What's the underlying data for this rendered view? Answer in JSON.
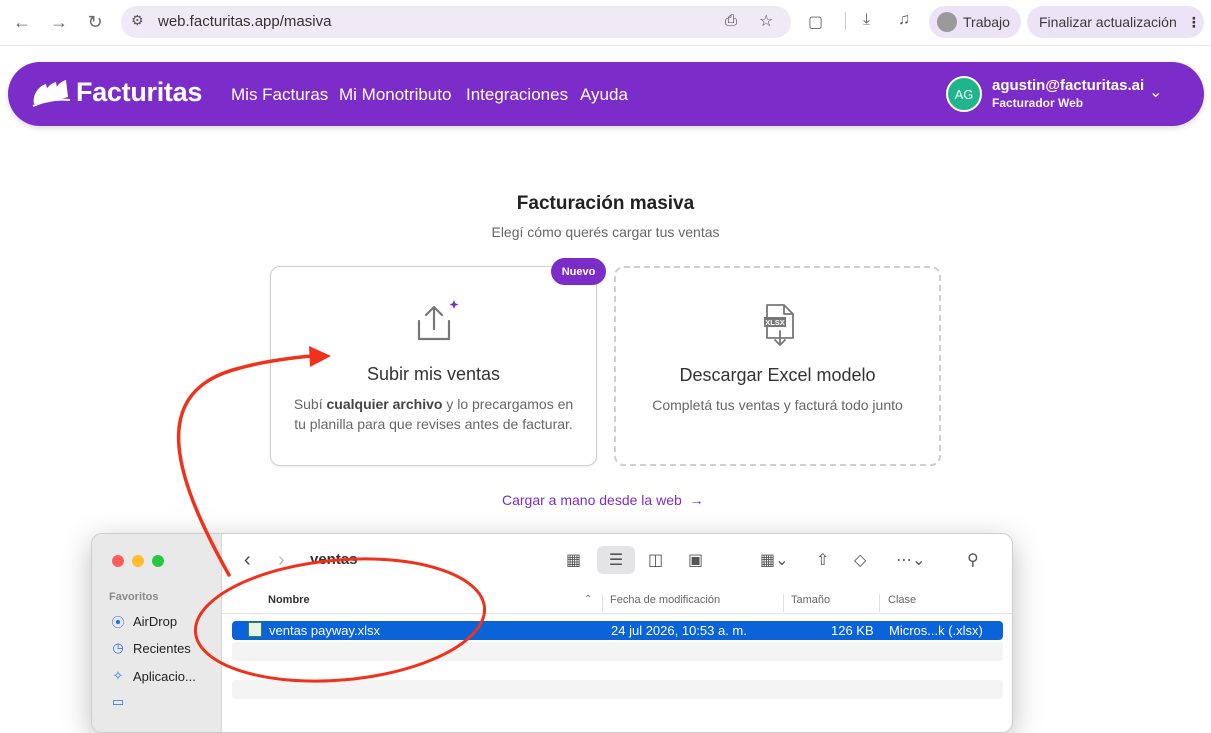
{
  "browser": {
    "url": "web.facturitas.app/masiva",
    "profile_label": "Trabajo",
    "update_label": "Finalizar actualización"
  },
  "header": {
    "brand": "Facturitas",
    "nav": [
      "Mis Facturas",
      "Mi Monotributo",
      "Integraciones",
      "Ayuda"
    ],
    "avatar_initials": "AG",
    "user_email": "agustin@facturitas.ai",
    "user_role": "Facturador Web"
  },
  "main": {
    "title": "Facturación masiva",
    "subtitle": "Elegí cómo querés cargar tus ventas",
    "upload_card": {
      "badge": "Nuevo",
      "title": "Subir mis ventas",
      "desc_pre": "Subí ",
      "desc_bold": "cualquier archivo",
      "desc_post": " y lo precargamos en tu planilla para que revises antes de facturar."
    },
    "download_card": {
      "icon_label": "XLSX",
      "title": "Descargar Excel modelo",
      "desc": "Completá tus ventas y facturá todo junto"
    },
    "manual_link": "Cargar a mano desde la web",
    "manual_arrow": "→"
  },
  "finder": {
    "folder": "ventas",
    "sidebar_section": "Favoritos",
    "sidebar_items": [
      "AirDrop",
      "Recientes",
      "Aplicacio..."
    ],
    "columns": [
      "Nombre",
      "Fecha de modificación",
      "Tamaño",
      "Clase"
    ],
    "file": {
      "name": "ventas payway.xlsx",
      "date": "24 jul 2026, 10:53 a. m.",
      "size": "126 KB",
      "kind": "Micros...k (.xlsx)"
    }
  },
  "colors": {
    "brand": "#7b2cc9",
    "avatar": "#1fb58c",
    "annotation": "#f0321c",
    "selection": "#0a63d8"
  }
}
